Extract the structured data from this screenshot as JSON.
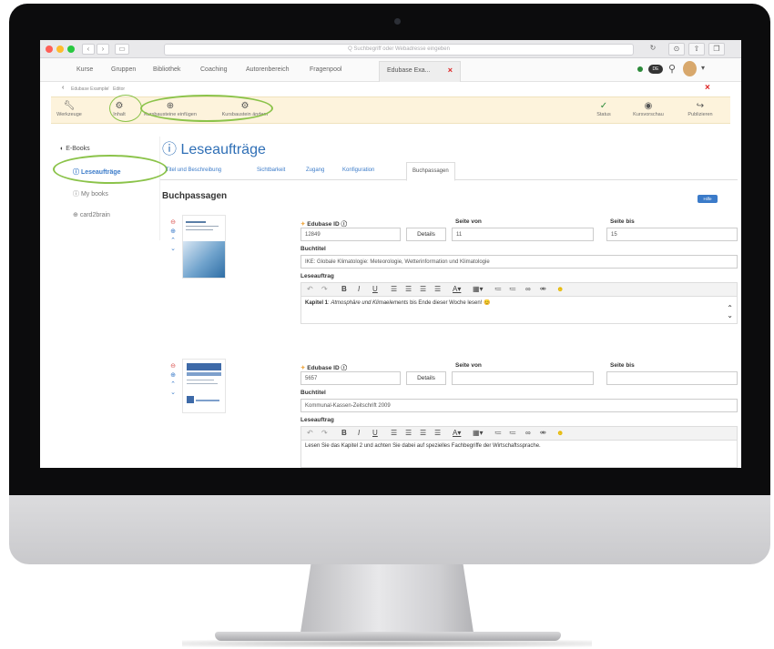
{
  "browser": {
    "address_placeholder": "Q Suchbegriff oder Webadresse eingeben",
    "back": "‹",
    "forward": "›"
  },
  "nav": {
    "items": [
      "Kurse",
      "Gruppen",
      "Bibliothek",
      "Coaching",
      "Autorenbereich",
      "Fragenpool"
    ],
    "active_tab": "Edubase Exa...",
    "close_glyph": "×",
    "user_initials": "DE"
  },
  "breadcrumb": [
    "Edubase Example",
    "Editor"
  ],
  "toolbar": {
    "left": [
      {
        "label": "Werkzeuge",
        "icon": "wrench-icon"
      },
      {
        "label": "Inhalt",
        "icon": "insert-icon"
      },
      {
        "label": "Kursbausteine einfügen",
        "icon": "add-element-icon"
      },
      {
        "label": "Kursbaustein ändern",
        "icon": "change-element-icon"
      }
    ],
    "right": [
      {
        "label": "Status",
        "icon": "status-icon"
      },
      {
        "label": "Kursvorschau",
        "icon": "preview-icon"
      },
      {
        "label": "Publizieren",
        "icon": "publish-icon"
      }
    ]
  },
  "sidebar": {
    "items": [
      {
        "label": "E-Books",
        "icon": "book-icon"
      },
      {
        "label": "Leseaufträge",
        "icon": "reading-icon"
      },
      {
        "label": "My books",
        "icon": "book-icon"
      },
      {
        "label": "card2brain",
        "icon": "card-icon"
      }
    ]
  },
  "page": {
    "title": "Leseaufträge",
    "tabs": [
      "Titel und Beschreibung",
      "Sichtbarkeit",
      "Zugang",
      "Konfiguration",
      "Buchpassagen"
    ],
    "section": "Buchpassagen",
    "help": "Hilfe"
  },
  "labels": {
    "edubase_id": "Edubase ID",
    "seite_von": "Seite von",
    "seite_bis": "Seite bis",
    "buchtitel": "Buchtitel",
    "leseauftrag": "Leseauftrag",
    "details": "Details"
  },
  "passages": [
    {
      "edubase_id": "12849",
      "seite_von": "11",
      "seite_bis": "15",
      "buchtitel": "IKE: Globale Klimatologie: Meteorologie, Wetterinformation und Klimatologie",
      "leseauftrag_prefix": "Kapitel 1",
      "leseauftrag_emph": "Atmosphäre und Klimaelements",
      "leseauftrag_suffix": "bis Ende dieser Woche lesen! 😊"
    },
    {
      "edubase_id": "5657",
      "seite_von": "",
      "seite_bis": "",
      "buchtitel": "Kommunal-Kassen-Zeitschrift 2009",
      "leseauftrag_text": "Lesen Sie das Kapitel 2 und achten Sie dabei auf spezielles Fachbegriffe der Wirtschaftssprache."
    }
  ]
}
